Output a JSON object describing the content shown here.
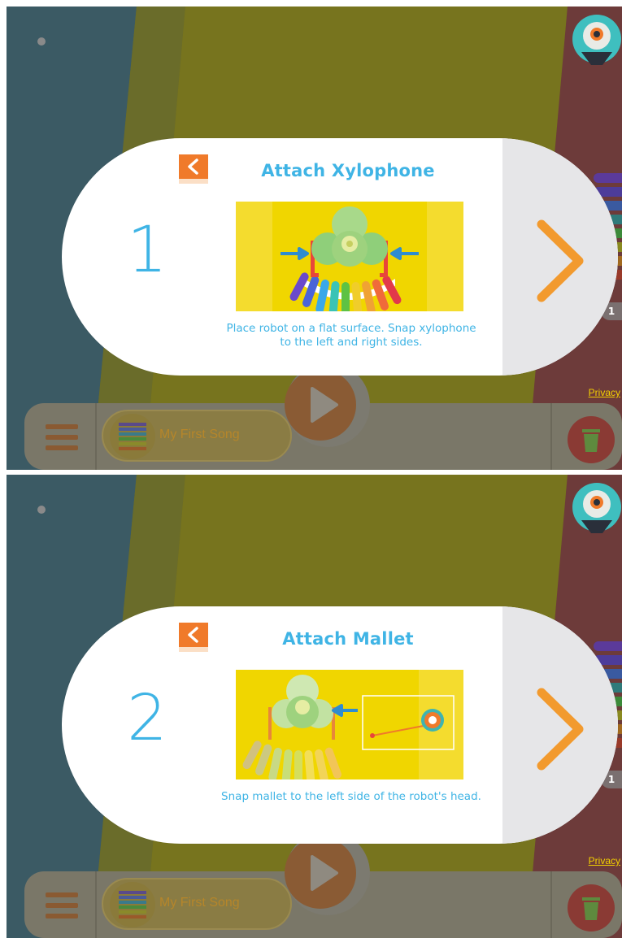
{
  "panels": [
    {
      "step_number": "1",
      "title": "Attach Xylophone",
      "caption": "Place robot on a flat surface. Snap xylophone to the left and right sides.",
      "illustration": "robot-with-xylophone"
    },
    {
      "step_number": "2",
      "title": "Attach Mallet",
      "caption": "Snap mallet to the left side of the robot's head.",
      "illustration": "robot-with-mallet"
    }
  ],
  "footer": {
    "song_name": "My First Song",
    "privacy_link": "Privacy",
    "count_badge": "1"
  },
  "icons": {
    "back": "chevron-left-icon",
    "next": "chevron-right-icon",
    "menu": "hamburger-menu-icon",
    "play": "play-icon",
    "trash": "trash-icon",
    "avatar": "robot-avatar-icon"
  },
  "colors": {
    "accent_blue": "#3fb4e5",
    "accent_orange": "#f29a2e",
    "back_button": "#f07a2a"
  }
}
